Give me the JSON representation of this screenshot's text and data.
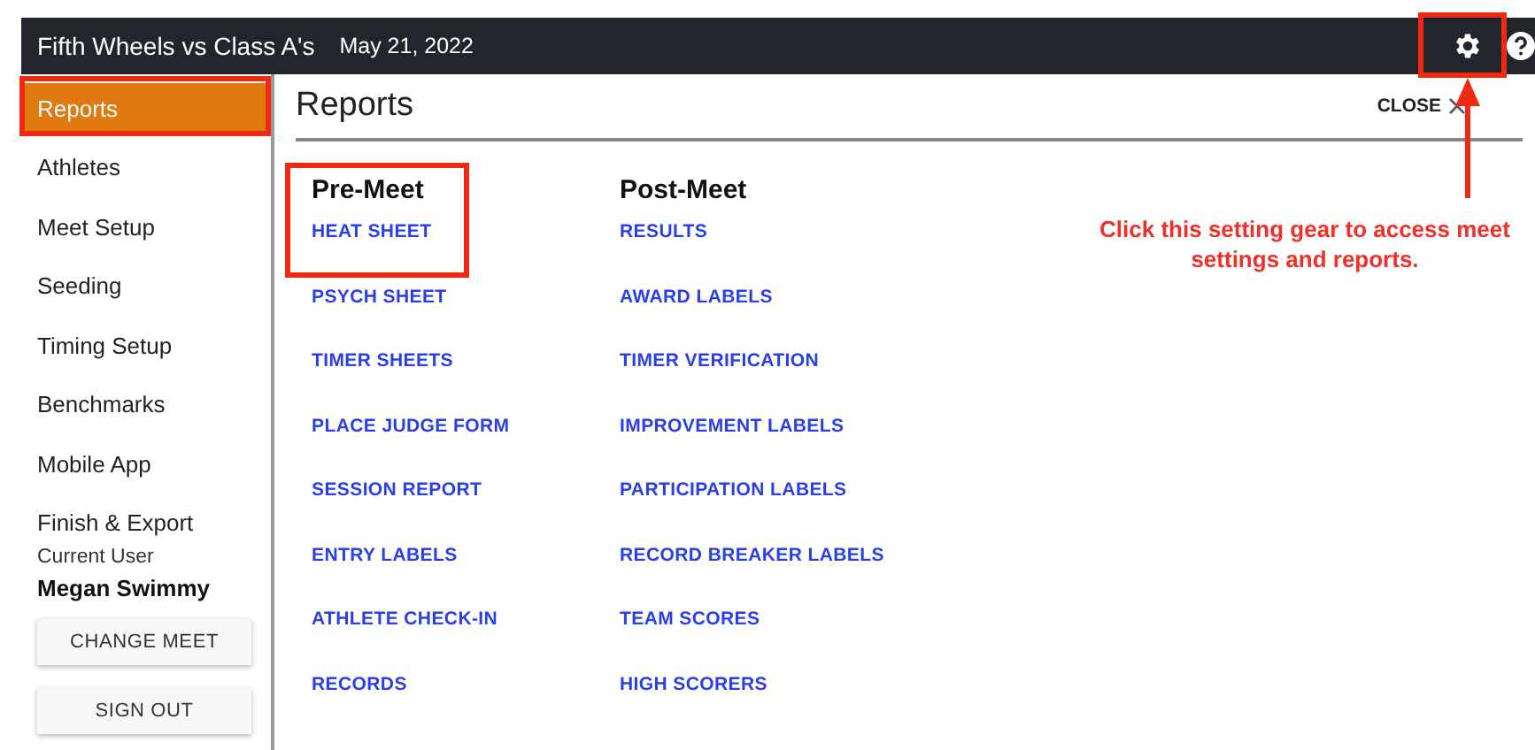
{
  "topbar": {
    "meet_name": "Fifth Wheels vs Class A's",
    "date": "May 21, 2022"
  },
  "sidebar": {
    "items": [
      {
        "label": "Reports",
        "selected": true
      },
      {
        "label": "Athletes",
        "selected": false
      },
      {
        "label": "Meet Setup",
        "selected": false
      },
      {
        "label": "Seeding",
        "selected": false
      },
      {
        "label": "Timing Setup",
        "selected": false
      },
      {
        "label": "Benchmarks",
        "selected": false
      },
      {
        "label": "Mobile App",
        "selected": false
      },
      {
        "label": "Finish & Export",
        "selected": false
      }
    ],
    "user_label": "Current User",
    "user_name": "Megan Swimmy",
    "buttons": [
      "CHANGE MEET",
      "SIGN OUT"
    ]
  },
  "panel": {
    "title": "Reports",
    "close": "CLOSE",
    "columns": [
      {
        "heading": "Pre-Meet",
        "links": [
          "HEAT SHEET",
          "PSYCH SHEET",
          "TIMER SHEETS",
          "PLACE JUDGE FORM",
          "SESSION REPORT",
          "ENTRY LABELS",
          "ATHLETE CHECK-IN",
          "RECORDS"
        ]
      },
      {
        "heading": "Post-Meet",
        "links": [
          "RESULTS",
          "AWARD LABELS",
          "TIMER VERIFICATION",
          "IMPROVEMENT LABELS",
          "PARTICIPATION LABELS",
          "RECORD BREAKER LABELS",
          "TEAM SCORES",
          "HIGH SCORERS"
        ]
      }
    ]
  },
  "annotation": "Click this setting gear to access meet settings and reports."
}
